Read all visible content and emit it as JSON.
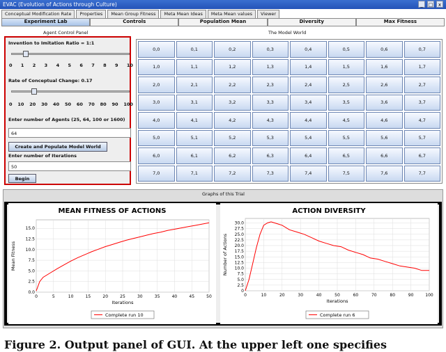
{
  "window": {
    "title": "EVAC (Evolution of Actions through Culture)",
    "controls": [
      "_",
      "□",
      "x"
    ]
  },
  "top_tabs": [
    "Conceptual Modification Rate",
    "Properties",
    "Mean Group Fitness",
    "Meta Mean Ideas",
    "Meta Mean values",
    "Viewer"
  ],
  "main_tabs": [
    {
      "label": "Experiment Lab",
      "active": true
    },
    {
      "label": "Controls",
      "active": false
    },
    {
      "label": "Population Mean",
      "active": false
    },
    {
      "label": "Diversity",
      "active": false
    },
    {
      "label": "Max Fitness",
      "active": false
    }
  ],
  "agent_panel": {
    "title": "Agent Control Panel",
    "ratio_label": "Invention to Imitation Ratio = 1:1",
    "ratio_ticks": [
      "0",
      "1",
      "2",
      "3",
      "4",
      "5",
      "6",
      "7",
      "8",
      "9",
      "10"
    ],
    "ratio_value": 1,
    "change_label": "Rate of Conceptual Change: 0.17",
    "change_ticks": [
      "0",
      "10",
      "20",
      "30",
      "40",
      "50",
      "60",
      "70",
      "80",
      "90",
      "100"
    ],
    "change_value": 17,
    "agents_label": "Enter number of Agents (25, 64, 100 or 1600)",
    "agents_value": "64",
    "create_button": "Create and Populate Model World",
    "iterations_label": "Enter number of Iterations",
    "iterations_value": "50",
    "begin_button": "Begin"
  },
  "model_world": {
    "title": "The Model World",
    "rows": [
      [
        "0,0",
        "0,1",
        "0,2",
        "0,3",
        "0,4",
        "0,5",
        "0,6",
        "0,7"
      ],
      [
        "1,0",
        "1,1",
        "1,2",
        "1,3",
        "1,4",
        "1,5",
        "1,6",
        "1,7"
      ],
      [
        "2,0",
        "2,1",
        "2,2",
        "2,3",
        "2,4",
        "2,5",
        "2,6",
        "2,7"
      ],
      [
        "3,0",
        "3,1",
        "3,2",
        "3,3",
        "3,4",
        "3,5",
        "3,6",
        "3,7"
      ],
      [
        "4,0",
        "4,1",
        "4,2",
        "4,3",
        "4,4",
        "4,5",
        "4,6",
        "4,7"
      ],
      [
        "5,0",
        "5,1",
        "5,2",
        "5,3",
        "5,4",
        "5,5",
        "5,6",
        "5,7"
      ],
      [
        "6,0",
        "6,1",
        "6,2",
        "6,3",
        "6,4",
        "6,5",
        "6,6",
        "6,7"
      ],
      [
        "7,0",
        "7,1",
        "7,2",
        "7,3",
        "7,4",
        "7,5",
        "7,6",
        "7,7"
      ]
    ]
  },
  "graphs_title": "Graphs of this Trial",
  "chart_data": [
    {
      "type": "line",
      "title": "MEAN FITNESS OF ACTIONS",
      "xlabel": "Iterations",
      "ylabel": "Mean Fitness",
      "xlim": [
        0,
        50
      ],
      "ylim": [
        0,
        17
      ],
      "xticks": [
        "0",
        "5",
        "10",
        "15",
        "20",
        "25",
        "30",
        "35",
        "40",
        "45",
        "50"
      ],
      "yticks": [
        "0.0",
        "2.5",
        "5.0",
        "7.5",
        "10.0",
        "12.5",
        "15.0"
      ],
      "grid": true,
      "legend_position": "bottom",
      "series": [
        {
          "name": "Complete run 10",
          "color": "#ff0000",
          "x": [
            0,
            1,
            2,
            4,
            6,
            8,
            10,
            12,
            14,
            16,
            18,
            20,
            22,
            24,
            26,
            28,
            30,
            32,
            34,
            36,
            38,
            40,
            42,
            44,
            46,
            48,
            50
          ],
          "y": [
            0.3,
            2.5,
            3.5,
            4.5,
            5.5,
            6.4,
            7.3,
            8.1,
            8.8,
            9.5,
            10.1,
            10.7,
            11.2,
            11.7,
            12.2,
            12.6,
            13.0,
            13.4,
            13.8,
            14.1,
            14.5,
            14.8,
            15.1,
            15.4,
            15.7,
            16.0,
            16.3
          ]
        }
      ]
    },
    {
      "type": "line",
      "title": "ACTION DIVERSITY",
      "xlabel": "Iterations",
      "ylabel": "Number of Actions",
      "xlim": [
        0,
        100
      ],
      "ylim": [
        0,
        32
      ],
      "xticks": [
        "0",
        "10",
        "20",
        "30",
        "40",
        "50",
        "60",
        "70",
        "80",
        "90",
        "100"
      ],
      "yticks": [
        "0",
        "2.5",
        "5.0",
        "7.5",
        "10.0",
        "12.5",
        "15.0",
        "17.5",
        "20.0",
        "22.5",
        "25.0",
        "27.5",
        "30.0"
      ],
      "grid": true,
      "legend_position": "bottom",
      "series": [
        {
          "name": "Complete run 6",
          "color": "#ff0000",
          "x": [
            0,
            2,
            4,
            6,
            8,
            10,
            12,
            14,
            16,
            18,
            20,
            24,
            28,
            32,
            36,
            40,
            44,
            48,
            52,
            56,
            60,
            64,
            68,
            72,
            76,
            80,
            84,
            88,
            92,
            96,
            100
          ],
          "y": [
            0,
            5,
            12,
            19,
            25,
            29,
            30,
            30.5,
            30,
            29.5,
            29,
            27,
            26,
            25,
            23.5,
            22,
            21,
            20,
            19.5,
            18,
            17,
            16,
            14.5,
            14,
            13,
            12,
            11,
            10.5,
            10,
            9,
            9
          ]
        }
      ]
    }
  ],
  "caption": "Figure 2. Output panel of GUI. At the upper left one specifies"
}
